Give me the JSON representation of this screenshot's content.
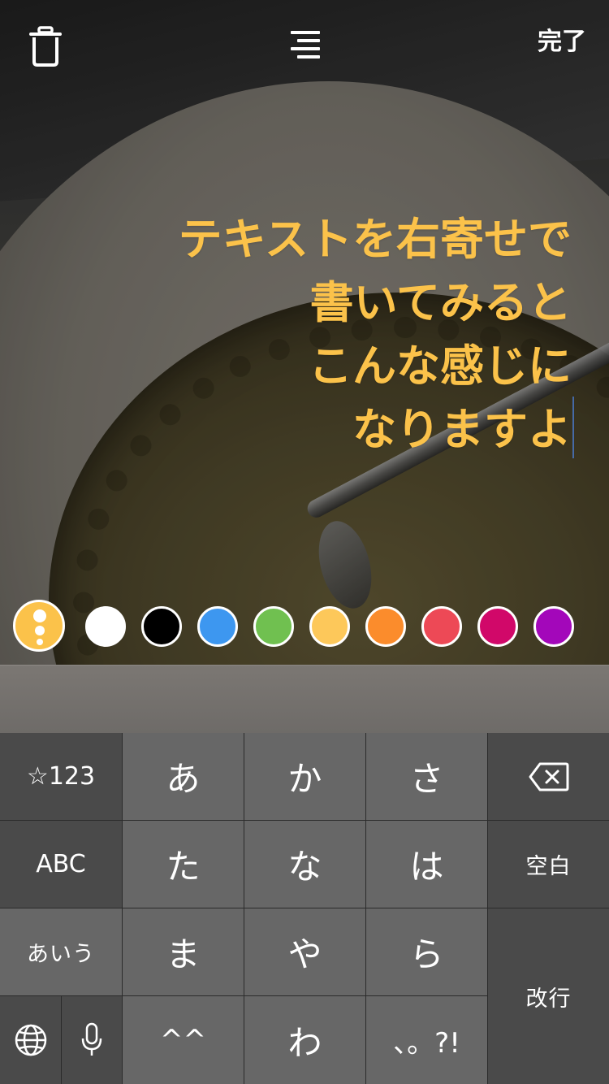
{
  "toolbar": {
    "trash_icon": "trash-icon",
    "align_icon": "align-right-icon",
    "done_label": "完了"
  },
  "story_text": {
    "lines": [
      "テキストを右寄せで",
      "書いてみると",
      "こんな感じに",
      "なりますよ"
    ],
    "color": "#fbc24a",
    "alignment": "right"
  },
  "palette": {
    "selected_color": "#fbc24a",
    "swatches": [
      "#ffffff",
      "#000000",
      "#3d97f0",
      "#70c050",
      "#fdc85a",
      "#fb8c2c",
      "#ed4956",
      "#d10869",
      "#a307ba"
    ]
  },
  "keyboard": {
    "row1": [
      "☆123",
      "あ",
      "か",
      "さ"
    ],
    "row2": [
      "ABC",
      "た",
      "な",
      "は",
      "空白"
    ],
    "row3": [
      "あいう",
      "ま",
      "や",
      "ら"
    ],
    "row4": [
      "^^",
      "わ",
      "、。?!"
    ],
    "return_label": "改行",
    "delete_icon": "delete-icon",
    "globe_icon": "globe-icon",
    "mic_icon": "microphone-icon"
  }
}
